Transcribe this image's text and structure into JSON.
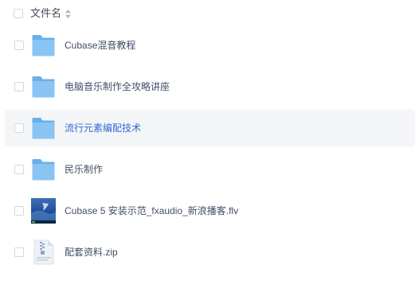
{
  "list": {
    "header": {
      "label": "文件名"
    },
    "rows": [
      {
        "name": "Cubase混音教程",
        "type": "folder",
        "icon": "folder-icon"
      },
      {
        "name": "电脑音乐制作全攻略讲座",
        "type": "folder",
        "icon": "folder-icon"
      },
      {
        "name": "流行元素编配技术",
        "type": "folder",
        "icon": "folder-icon",
        "hovered": true
      },
      {
        "name": "民乐制作",
        "type": "folder",
        "icon": "folder-icon"
      },
      {
        "name": "Cubase 5 安装示范_fxaudio_新浪播客.flv",
        "type": "video",
        "icon": "video-thumbnail-icon"
      },
      {
        "name": "配套资料.zip",
        "type": "zip",
        "icon": "zip-file-icon"
      }
    ]
  },
  "colors": {
    "text": "#424e67",
    "hover_text": "#3269d6",
    "hover_background": "#f4f5f6",
    "folder": "#7ab8ee",
    "checkbox_border": "#d4d7de"
  }
}
